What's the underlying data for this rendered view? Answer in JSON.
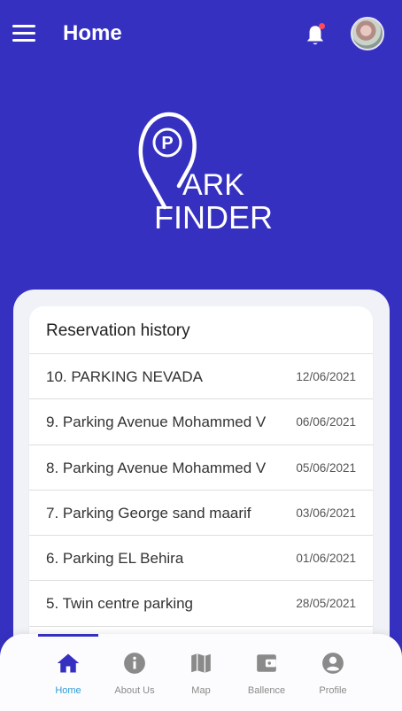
{
  "header": {
    "title": "Home",
    "menu_icon": "hamburger-menu-icon",
    "notification_icon": "bell-icon",
    "has_unread_notification": true,
    "avatar_icon": "user-avatar"
  },
  "logo": {
    "line1": "ARK",
    "line2": "FINDER",
    "pin_letter": "P"
  },
  "history": {
    "title": "Reservation history",
    "items": [
      {
        "name": "10. PARKING NEVADA",
        "date": "12/06/2021"
      },
      {
        "name": "9. Parking Avenue Mohammed V",
        "date": "06/06/2021"
      },
      {
        "name": "8. Parking Avenue Mohammed V",
        "date": "05/06/2021"
      },
      {
        "name": "7. Parking George sand maarif",
        "date": "03/06/2021"
      },
      {
        "name": "6. Parking EL Behira",
        "date": "01/06/2021"
      },
      {
        "name": "5. Twin centre parking",
        "date": "28/05/2021"
      }
    ]
  },
  "bottom_nav": {
    "active": "Home",
    "items": [
      {
        "label": "Home",
        "icon": "home-icon"
      },
      {
        "label": "About Us",
        "icon": "info-icon"
      },
      {
        "label": "Map",
        "icon": "map-icon"
      },
      {
        "label": "Ballence",
        "icon": "wallet-icon"
      },
      {
        "label": "Profile",
        "icon": "profile-icon"
      }
    ]
  },
  "colors": {
    "primary": "#3630c0",
    "active_label": "#2f9bd6",
    "inactive": "#8a8a8a",
    "notification_dot": "#ff4a5a"
  }
}
